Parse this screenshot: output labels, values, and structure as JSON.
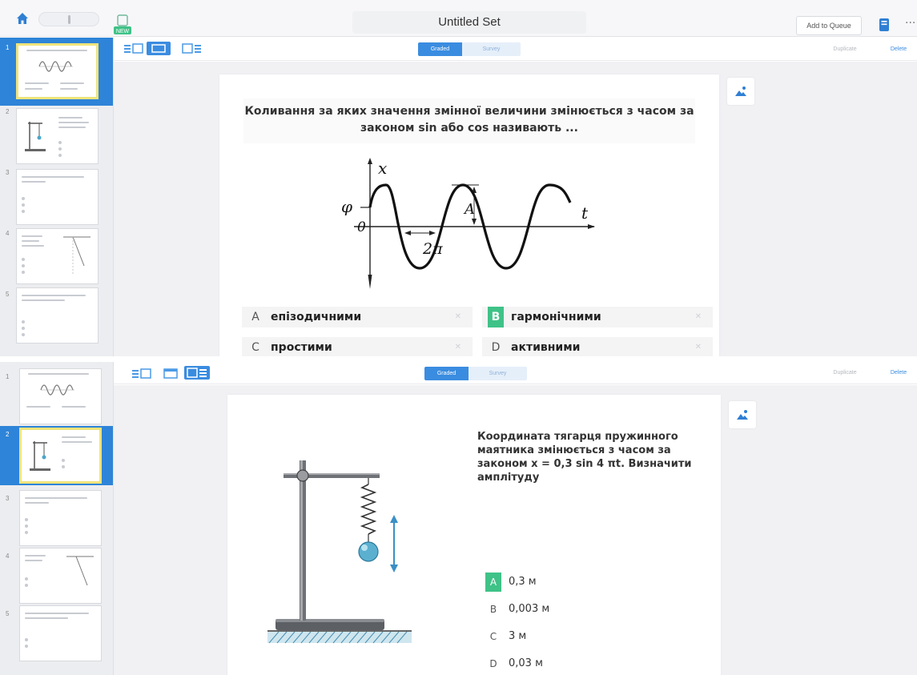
{
  "header": {
    "title": "Untitled Set",
    "add_to_queue": "Add to Queue",
    "more": "···",
    "new_badge": "NEW"
  },
  "toolbar": {
    "mode_graded": "Graded",
    "mode_survey": "Survey",
    "duplicate": "Duplicate",
    "delete": "Delete"
  },
  "sidebar": {
    "slides": [
      "1",
      "2",
      "3",
      "4",
      "5"
    ]
  },
  "question1": {
    "text": "Коливання за яких значення змінної величини змінюється з часом за законом sin або cos називають ...",
    "graph_labels": {
      "x_axis": "x",
      "t_axis": "t",
      "phi": "φ",
      "origin": "0",
      "amplitude": "A",
      "period": "2π"
    },
    "answers": [
      {
        "letter": "A",
        "text": "епізодичними",
        "correct": false
      },
      {
        "letter": "B",
        "text": "гармонічними",
        "correct": true
      },
      {
        "letter": "C",
        "text": "простими",
        "correct": false
      },
      {
        "letter": "D",
        "text": "активними",
        "correct": false
      }
    ],
    "remove_mark": "✕"
  },
  "question2": {
    "text": "Координата  тягарця пружинного маятника змінюється з часом за законом  x = 0,3 sin 4 πt. Визначити амплітуду",
    "answers": [
      {
        "letter": "A",
        "text": "0,3 м",
        "correct": true
      },
      {
        "letter": "B",
        "text": "0,003 м",
        "correct": false
      },
      {
        "letter": "C",
        "text": "3 м",
        "correct": false
      },
      {
        "letter": "D",
        "text": "0,03 м",
        "correct": false
      }
    ]
  },
  "colors": {
    "accent": "#3a8ce0",
    "correct": "#3fc287",
    "selection": "#2e84d8",
    "highlight": "#f0e47a"
  }
}
